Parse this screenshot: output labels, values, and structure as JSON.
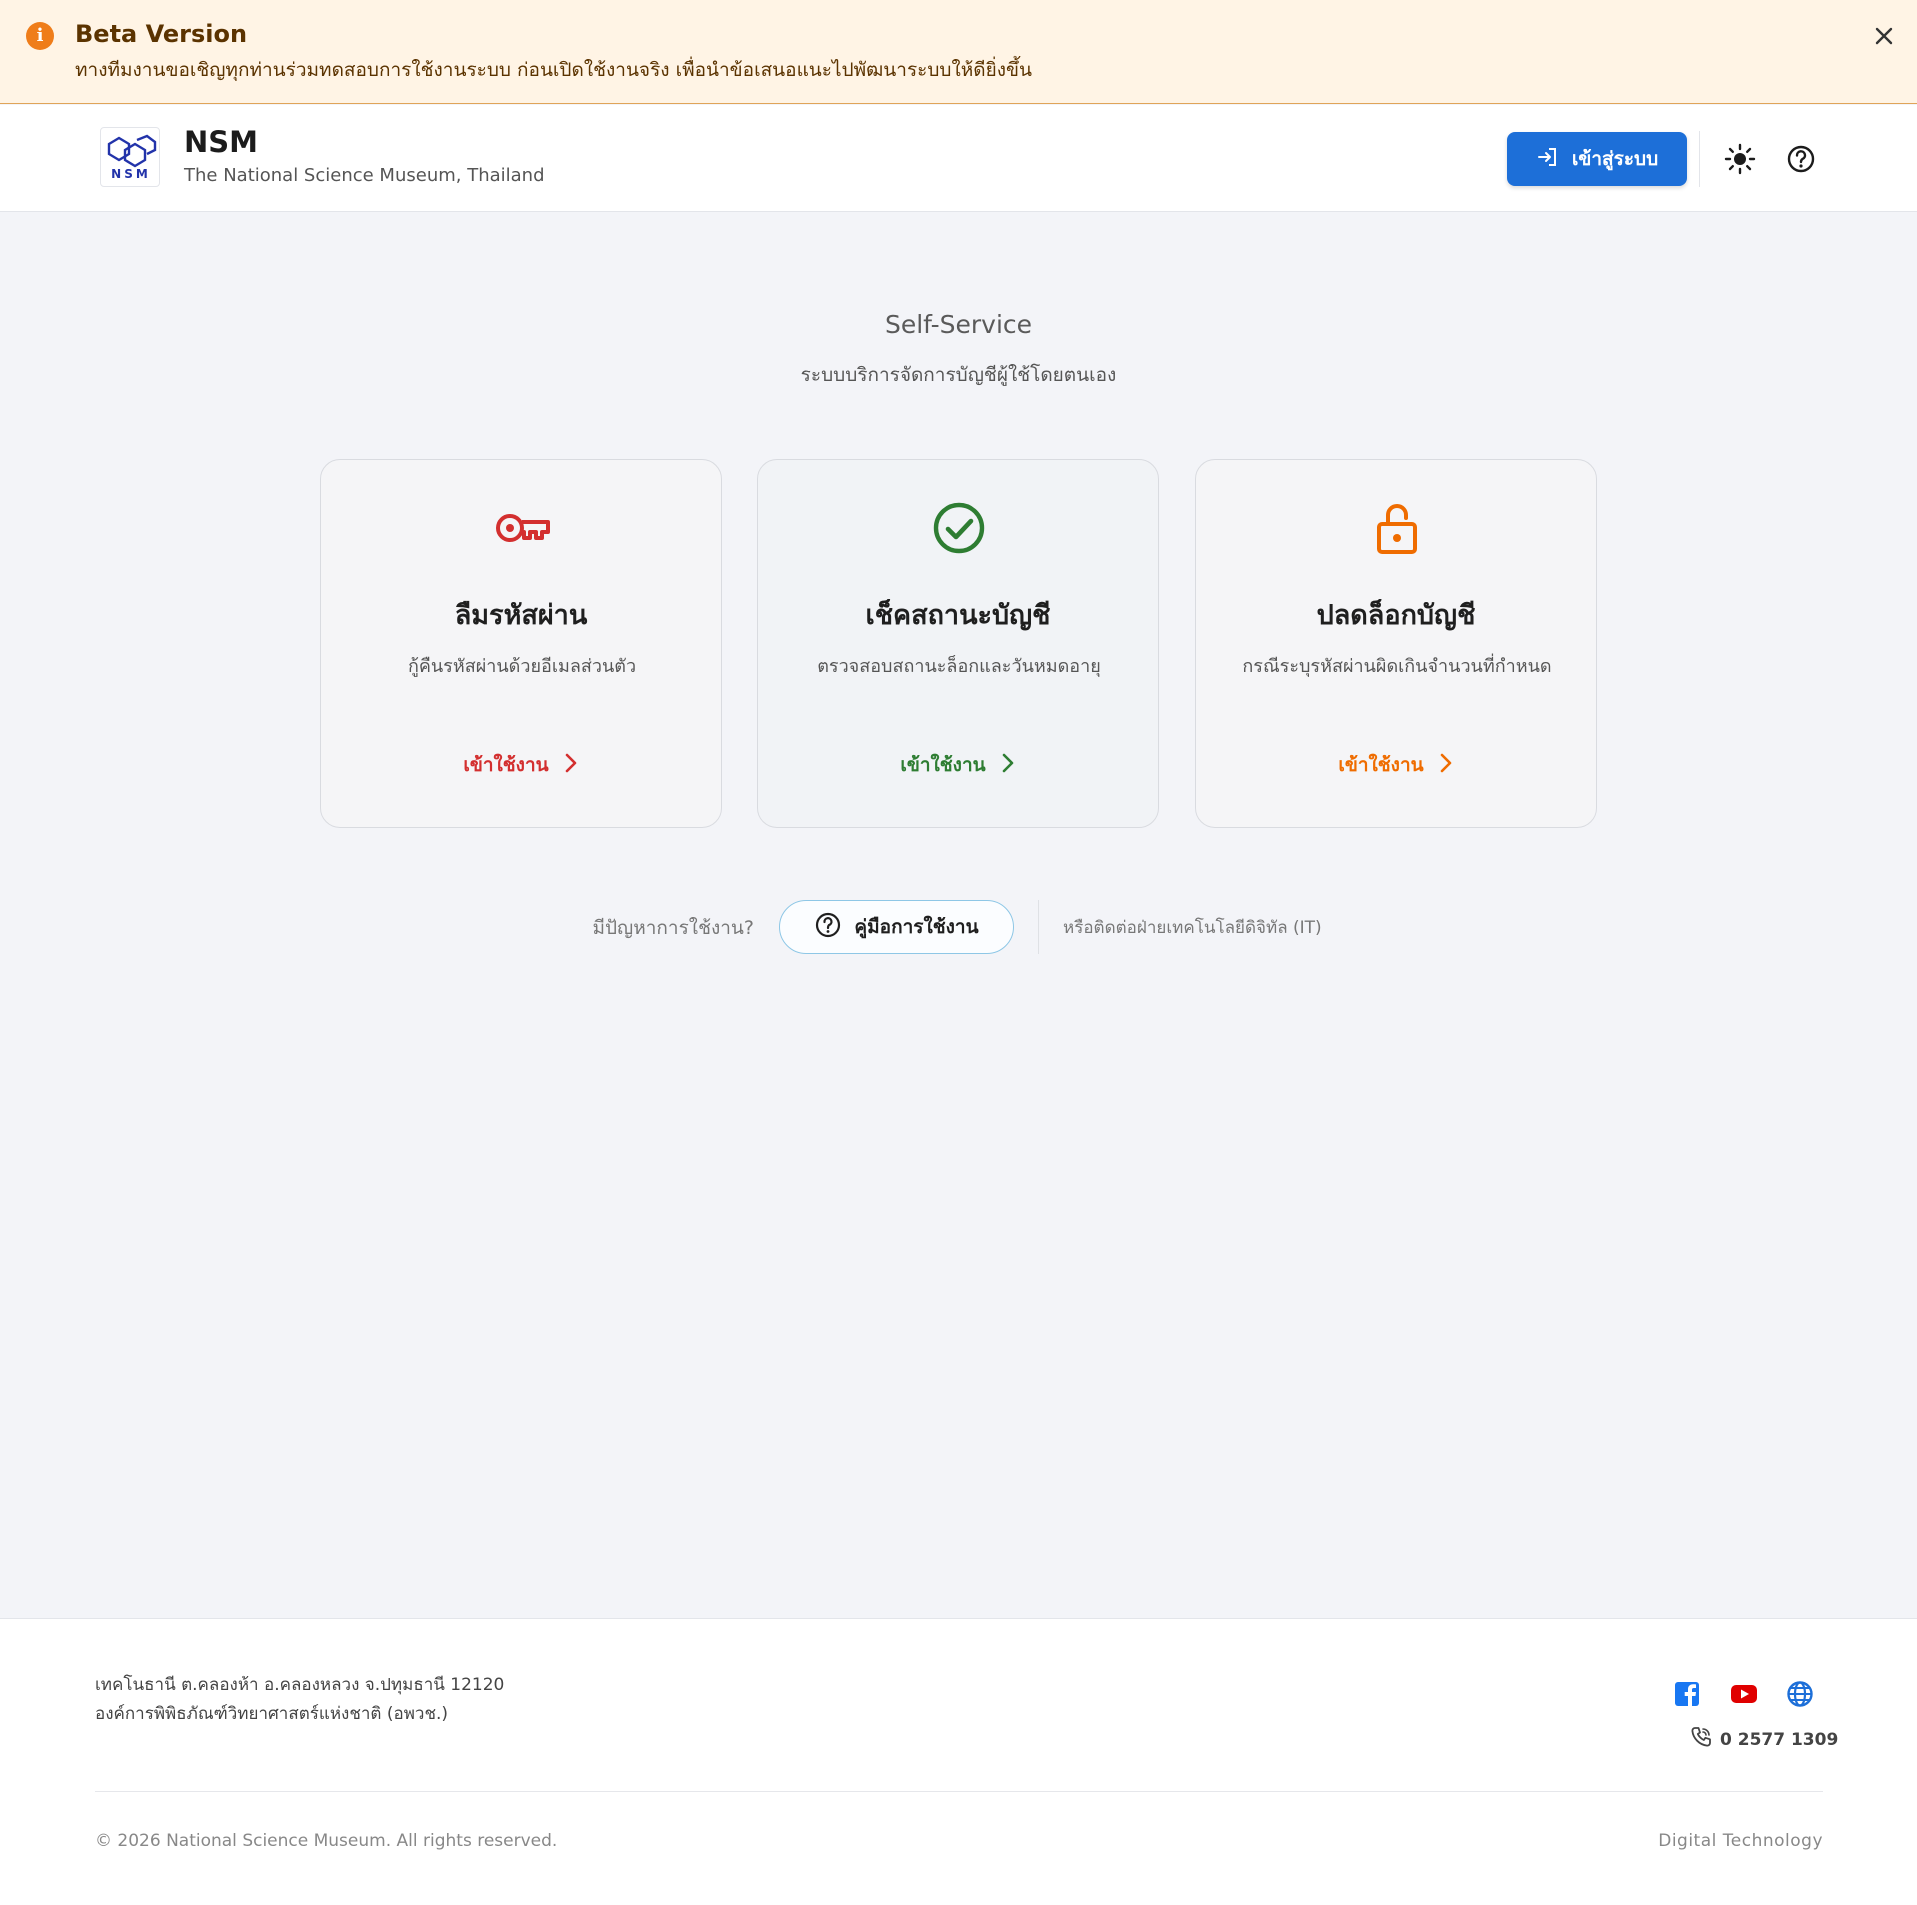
{
  "banner": {
    "title": "Beta Version",
    "message": "ทางทีมงานขอเชิญทุกท่านร่วมทดสอบการใช้งานระบบ ก่อนเปิดใช้งานจริง เพื่อนำข้อเสนอแนะไปพัฒนาระบบให้ดียิ่งขึ้น",
    "icon": "info-icon",
    "color": "#ef7d1a"
  },
  "header": {
    "brand_name": "NSM",
    "brand_subtitle": "The National Science Museum, Thailand",
    "logo_text": "NSM",
    "login_label": "เข้าสู่ระบบ",
    "accent": "#1d6fd8"
  },
  "main": {
    "title": "Self-Service",
    "subtitle": "ระบบบริการจัดการบัญชีผู้ใช้โดยตนเอง",
    "cards": [
      {
        "icon": "key-icon",
        "title": "ลืมรหัสผ่าน",
        "description": "กู้คืนรหัสผ่านด้วยอีเมลส่วนตัว",
        "link": "เข้าใช้งาน",
        "color": "#d32f2f"
      },
      {
        "icon": "check-circle-icon",
        "title": "เช็คสถานะบัญชี",
        "description": "ตรวจสอบสถานะล็อกและวันหมดอายุ",
        "link": "เข้าใช้งาน",
        "color": "#2e7d32"
      },
      {
        "icon": "unlock-icon",
        "title": "ปลดล็อกบัญชี",
        "description": "กรณีระบุรหัสผ่านผิดเกินจำนวนที่กำหนด",
        "link": "เข้าใช้งาน",
        "color": "#ef6c00"
      }
    ],
    "help": {
      "question": "มีปัญหาการใช้งาน?",
      "manual_label": "คู่มือการใช้งาน",
      "contact": "หรือติดต่อฝ่ายเทคโนโลยีดิจิทัล (IT)"
    }
  },
  "footer": {
    "address_line1": "เทคโนธานี ต.คลองห้า อ.คลองหลวง จ.ปทุมธานี 12120",
    "address_line2": "องค์การพิพิธภัณฑ์วิทยาศาสตร์แห่งชาติ (อพวช.)",
    "phone": "0 2577 1309",
    "copyright": "© 2026 National Science Museum. All rights reserved.",
    "department": "Digital Technology",
    "social": [
      "facebook-icon",
      "youtube-icon",
      "globe-icon"
    ]
  }
}
